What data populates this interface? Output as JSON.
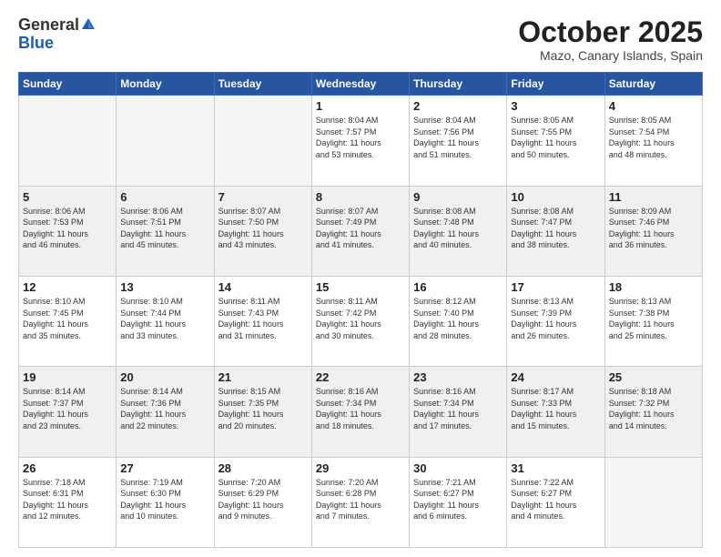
{
  "header": {
    "logo_general": "General",
    "logo_blue": "Blue",
    "month_title": "October 2025",
    "subtitle": "Mazo, Canary Islands, Spain"
  },
  "weekdays": [
    "Sunday",
    "Monday",
    "Tuesday",
    "Wednesday",
    "Thursday",
    "Friday",
    "Saturday"
  ],
  "weeks": [
    [
      {
        "day": "",
        "info": ""
      },
      {
        "day": "",
        "info": ""
      },
      {
        "day": "",
        "info": ""
      },
      {
        "day": "1",
        "info": "Sunrise: 8:04 AM\nSunset: 7:57 PM\nDaylight: 11 hours\nand 53 minutes."
      },
      {
        "day": "2",
        "info": "Sunrise: 8:04 AM\nSunset: 7:56 PM\nDaylight: 11 hours\nand 51 minutes."
      },
      {
        "day": "3",
        "info": "Sunrise: 8:05 AM\nSunset: 7:55 PM\nDaylight: 11 hours\nand 50 minutes."
      },
      {
        "day": "4",
        "info": "Sunrise: 8:05 AM\nSunset: 7:54 PM\nDaylight: 11 hours\nand 48 minutes."
      }
    ],
    [
      {
        "day": "5",
        "info": "Sunrise: 8:06 AM\nSunset: 7:53 PM\nDaylight: 11 hours\nand 46 minutes."
      },
      {
        "day": "6",
        "info": "Sunrise: 8:06 AM\nSunset: 7:51 PM\nDaylight: 11 hours\nand 45 minutes."
      },
      {
        "day": "7",
        "info": "Sunrise: 8:07 AM\nSunset: 7:50 PM\nDaylight: 11 hours\nand 43 minutes."
      },
      {
        "day": "8",
        "info": "Sunrise: 8:07 AM\nSunset: 7:49 PM\nDaylight: 11 hours\nand 41 minutes."
      },
      {
        "day": "9",
        "info": "Sunrise: 8:08 AM\nSunset: 7:48 PM\nDaylight: 11 hours\nand 40 minutes."
      },
      {
        "day": "10",
        "info": "Sunrise: 8:08 AM\nSunset: 7:47 PM\nDaylight: 11 hours\nand 38 minutes."
      },
      {
        "day": "11",
        "info": "Sunrise: 8:09 AM\nSunset: 7:46 PM\nDaylight: 11 hours\nand 36 minutes."
      }
    ],
    [
      {
        "day": "12",
        "info": "Sunrise: 8:10 AM\nSunset: 7:45 PM\nDaylight: 11 hours\nand 35 minutes."
      },
      {
        "day": "13",
        "info": "Sunrise: 8:10 AM\nSunset: 7:44 PM\nDaylight: 11 hours\nand 33 minutes."
      },
      {
        "day": "14",
        "info": "Sunrise: 8:11 AM\nSunset: 7:43 PM\nDaylight: 11 hours\nand 31 minutes."
      },
      {
        "day": "15",
        "info": "Sunrise: 8:11 AM\nSunset: 7:42 PM\nDaylight: 11 hours\nand 30 minutes."
      },
      {
        "day": "16",
        "info": "Sunrise: 8:12 AM\nSunset: 7:40 PM\nDaylight: 11 hours\nand 28 minutes."
      },
      {
        "day": "17",
        "info": "Sunrise: 8:13 AM\nSunset: 7:39 PM\nDaylight: 11 hours\nand 26 minutes."
      },
      {
        "day": "18",
        "info": "Sunrise: 8:13 AM\nSunset: 7:38 PM\nDaylight: 11 hours\nand 25 minutes."
      }
    ],
    [
      {
        "day": "19",
        "info": "Sunrise: 8:14 AM\nSunset: 7:37 PM\nDaylight: 11 hours\nand 23 minutes."
      },
      {
        "day": "20",
        "info": "Sunrise: 8:14 AM\nSunset: 7:36 PM\nDaylight: 11 hours\nand 22 minutes."
      },
      {
        "day": "21",
        "info": "Sunrise: 8:15 AM\nSunset: 7:35 PM\nDaylight: 11 hours\nand 20 minutes."
      },
      {
        "day": "22",
        "info": "Sunrise: 8:16 AM\nSunset: 7:34 PM\nDaylight: 11 hours\nand 18 minutes."
      },
      {
        "day": "23",
        "info": "Sunrise: 8:16 AM\nSunset: 7:34 PM\nDaylight: 11 hours\nand 17 minutes."
      },
      {
        "day": "24",
        "info": "Sunrise: 8:17 AM\nSunset: 7:33 PM\nDaylight: 11 hours\nand 15 minutes."
      },
      {
        "day": "25",
        "info": "Sunrise: 8:18 AM\nSunset: 7:32 PM\nDaylight: 11 hours\nand 14 minutes."
      }
    ],
    [
      {
        "day": "26",
        "info": "Sunrise: 7:18 AM\nSunset: 6:31 PM\nDaylight: 11 hours\nand 12 minutes."
      },
      {
        "day": "27",
        "info": "Sunrise: 7:19 AM\nSunset: 6:30 PM\nDaylight: 11 hours\nand 10 minutes."
      },
      {
        "day": "28",
        "info": "Sunrise: 7:20 AM\nSunset: 6:29 PM\nDaylight: 11 hours\nand 9 minutes."
      },
      {
        "day": "29",
        "info": "Sunrise: 7:20 AM\nSunset: 6:28 PM\nDaylight: 11 hours\nand 7 minutes."
      },
      {
        "day": "30",
        "info": "Sunrise: 7:21 AM\nSunset: 6:27 PM\nDaylight: 11 hours\nand 6 minutes."
      },
      {
        "day": "31",
        "info": "Sunrise: 7:22 AM\nSunset: 6:27 PM\nDaylight: 11 hours\nand 4 minutes."
      },
      {
        "day": "",
        "info": ""
      }
    ]
  ]
}
